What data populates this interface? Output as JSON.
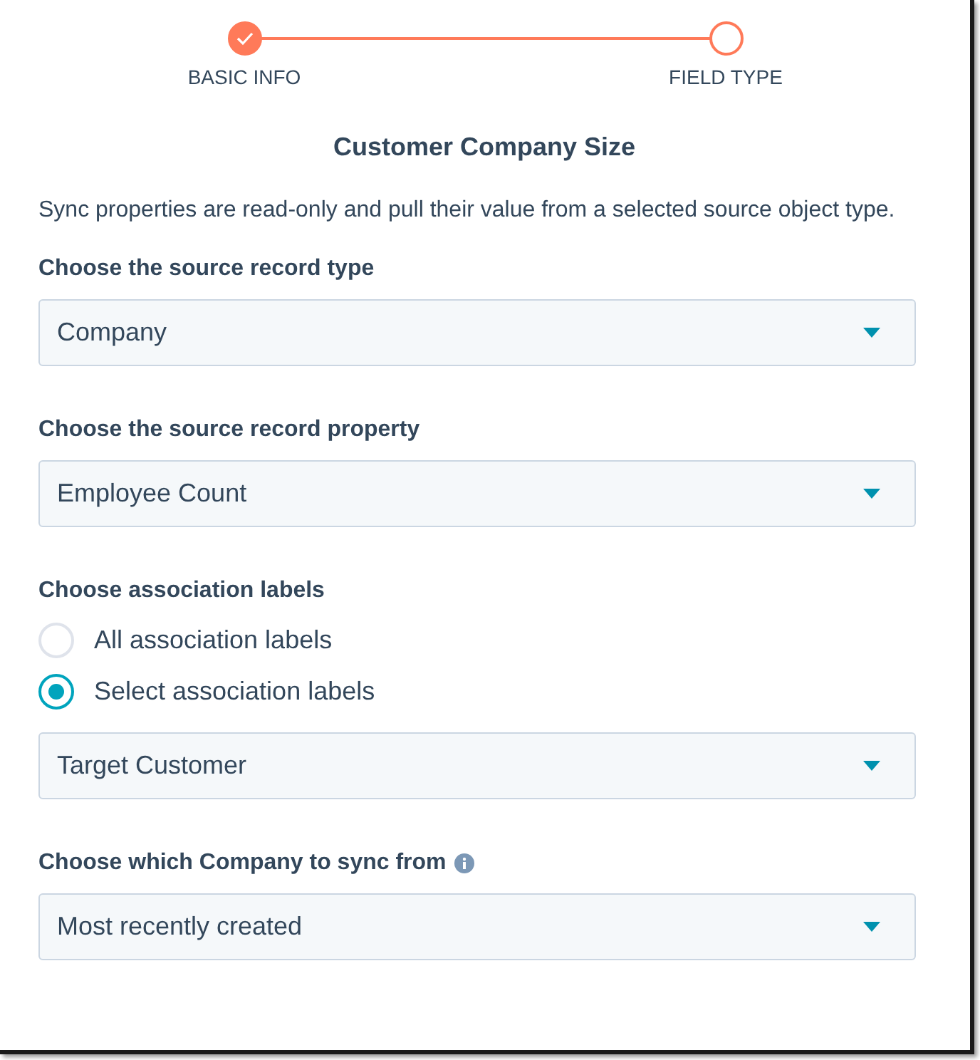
{
  "steps": [
    {
      "label": "BASIC INFO",
      "completed": true
    },
    {
      "label": "FIELD TYPE",
      "completed": false
    }
  ],
  "title": "Customer Company Size",
  "description": "Sync properties are read-only and pull their value from a selected source object type.",
  "fields": [
    {
      "kind": "select",
      "label": "Choose the source record type",
      "value": "Company"
    },
    {
      "kind": "select",
      "label": "Choose the source record property",
      "value": "Employee Count"
    },
    {
      "kind": "radio-select",
      "label": "Choose association labels",
      "options": [
        {
          "label": "All association labels",
          "selected": false
        },
        {
          "label": "Select association labels",
          "selected": true
        }
      ],
      "value": "Target Customer"
    },
    {
      "kind": "select",
      "label": "Choose which Company to sync from",
      "info": true,
      "value": "Most recently created"
    }
  ]
}
